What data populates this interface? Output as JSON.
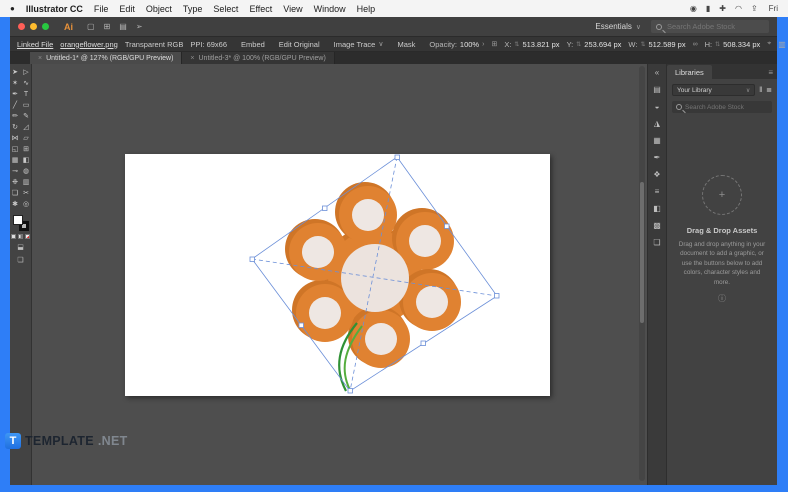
{
  "menubar": {
    "app_name": "Illustrator CC",
    "items": [
      "File",
      "Edit",
      "Object",
      "Type",
      "Select",
      "Effect",
      "View",
      "Window",
      "Help"
    ],
    "clock": "Fri",
    "status_icons": [
      {
        "name": "siri-icon",
        "glyph": "◉"
      },
      {
        "name": "battery-icon",
        "glyph": "▮"
      },
      {
        "name": "control-center-icon",
        "glyph": "✚"
      },
      {
        "name": "wifi-icon",
        "glyph": "◠"
      },
      {
        "name": "spotlight-icon",
        "glyph": "⇪"
      }
    ]
  },
  "titlebar": {
    "app_logo": "Ai",
    "doc_icons": [
      {
        "name": "new-document-icon",
        "glyph": "▢"
      },
      {
        "name": "grid-icon",
        "glyph": "⊞"
      },
      {
        "name": "layout-icon",
        "glyph": "▤"
      },
      {
        "name": "share-icon",
        "glyph": "➢"
      }
    ],
    "workspace": "Essentials",
    "search_placeholder": "Search Adobe Stock"
  },
  "control_bar": {
    "linked_file": "Linked File",
    "filename": "orangeflower.png",
    "color_mode": "Transparent RGB",
    "ppi": "PPI: 69x66",
    "embed": "Embed",
    "edit_original": "Edit Original",
    "image_trace": "Image Trace",
    "mask": "Mask",
    "opacity_label": "Opacity:",
    "opacity_value": "100%",
    "x_label": "X:",
    "x_value": "513.821 px",
    "y_label": "Y:",
    "y_value": "253.694 px",
    "w_label": "W:",
    "w_value": "512.589 px",
    "h_label": "H:",
    "h_value": "508.334 px",
    "right_icons": [
      {
        "name": "align-panel-icon",
        "glyph": "▥"
      },
      {
        "name": "workspace-caret-icon",
        "glyph": "∨"
      },
      {
        "name": "panel-menu-icon",
        "glyph": "≡"
      }
    ]
  },
  "tabs": [
    {
      "label": "Untitled-1* @ 127% (RGB/GPU Preview)"
    },
    {
      "label": "Untitled-3* @ 100% (RGB/GPU Preview)"
    }
  ],
  "toolbar": {
    "tools": [
      {
        "name": "selection-tool-icon",
        "glyph": "➤"
      },
      {
        "name": "direct-selection-tool-icon",
        "glyph": "▷"
      },
      {
        "name": "magic-wand-tool-icon",
        "glyph": "✶"
      },
      {
        "name": "lasso-tool-icon",
        "glyph": "∿"
      },
      {
        "name": "pen-tool-icon",
        "glyph": "✒"
      },
      {
        "name": "type-tool-icon",
        "glyph": "T"
      },
      {
        "name": "line-segment-tool-icon",
        "glyph": "╱"
      },
      {
        "name": "rectangle-tool-icon",
        "glyph": "▭"
      },
      {
        "name": "paintbrush-tool-icon",
        "glyph": "✏"
      },
      {
        "name": "pencil-tool-icon",
        "glyph": "✎"
      },
      {
        "name": "rotate-tool-icon",
        "glyph": "↻"
      },
      {
        "name": "scale-tool-icon",
        "glyph": "◿"
      },
      {
        "name": "width-tool-icon",
        "glyph": "⋈"
      },
      {
        "name": "free-transform-tool-icon",
        "glyph": "▱"
      },
      {
        "name": "shape-builder-tool-icon",
        "glyph": "◱"
      },
      {
        "name": "perspective-grid-tool-icon",
        "glyph": "⊞"
      },
      {
        "name": "mesh-tool-icon",
        "glyph": "▦"
      },
      {
        "name": "gradient-tool-icon",
        "glyph": "◧"
      },
      {
        "name": "eyedropper-tool-icon",
        "glyph": "⊸"
      },
      {
        "name": "blend-tool-icon",
        "glyph": "◍"
      },
      {
        "name": "symbol-sprayer-tool-icon",
        "glyph": "❉"
      },
      {
        "name": "graph-tool-icon",
        "glyph": "▥"
      },
      {
        "name": "artboard-tool-icon",
        "glyph": "❏"
      },
      {
        "name": "slice-tool-icon",
        "glyph": "✂"
      },
      {
        "name": "hand-tool-icon",
        "glyph": "✱"
      },
      {
        "name": "zoom-tool-icon",
        "glyph": "◎"
      }
    ]
  },
  "right_strip": {
    "icons": [
      {
        "name": "collapse-panels-icon",
        "glyph": "«"
      },
      {
        "name": "properties-panel-icon",
        "glyph": "▤"
      },
      {
        "name": "color-panel-icon",
        "glyph": "◒"
      },
      {
        "name": "color-guide-panel-icon",
        "glyph": "◮"
      },
      {
        "name": "swatches-panel-icon",
        "glyph": "▦"
      },
      {
        "name": "brushes-panel-icon",
        "glyph": "✒"
      },
      {
        "name": "symbols-panel-icon",
        "glyph": "❖"
      },
      {
        "name": "stroke-panel-icon",
        "glyph": "≡"
      },
      {
        "name": "gradient-panel-icon",
        "glyph": "◧"
      },
      {
        "name": "transparency-panel-icon",
        "glyph": "▩"
      },
      {
        "name": "layers-panel-icon",
        "glyph": "❏"
      }
    ]
  },
  "libraries_panel": {
    "title": "Libraries",
    "library_name": "Your Library",
    "search_placeholder": "Search Adobe Stock",
    "empty_state": {
      "title": "Drag & Drop Assets",
      "body": "Drag and drop anything in your document to add a graphic, or use the buttons below to add colors, character styles and more."
    }
  },
  "watermark": {
    "badge": "T",
    "brand": "TEMPLATE",
    "tld": ".NET"
  },
  "icons": {
    "apple": "●",
    "caret_down": "∨",
    "chevron_right": "›",
    "close": "×",
    "plus": "+",
    "info": "ⓘ",
    "menu": "≡",
    "link": "∞",
    "locator": "⊞",
    "steppers": "⇅",
    "transform": "⌖",
    "pause": "‖",
    "list": "≣"
  },
  "artwork": {
    "description": "orange six-petal flower with green stem on white artboard, selected with rotated blue bounding box",
    "colors": {
      "petal": "#e08231",
      "petal_shadow": "#cf7527",
      "petal_inner": "#eee7e3",
      "center": "#ece3de",
      "stem": "#2f9135",
      "stem_light": "#55ad3e",
      "selection": "#6b8fd8",
      "handle_fill": "#ffffff"
    }
  }
}
